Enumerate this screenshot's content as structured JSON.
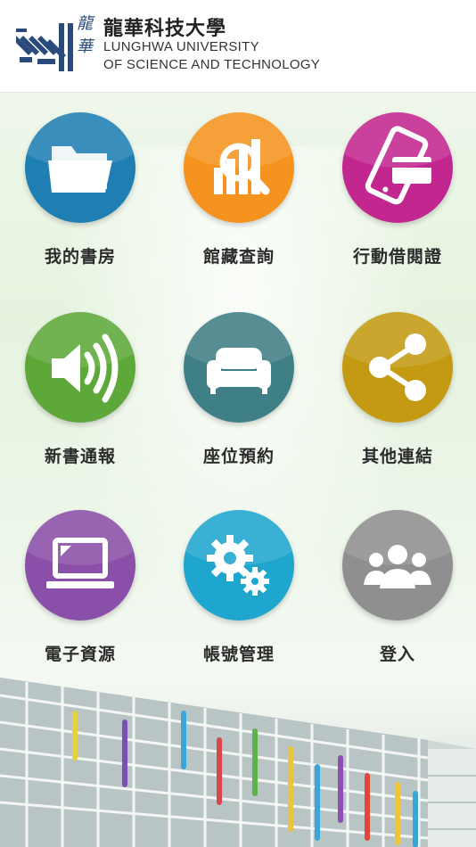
{
  "header": {
    "logo_calligraphy": "龍華",
    "name_zh": "龍華科技大學",
    "name_en_line1": "LUNGHWA UNIVERSITY",
    "name_en_line2": "OF SCIENCE AND TECHNOLOGY"
  },
  "menu": [
    {
      "label": "我的書房",
      "icon": "folder-icon",
      "color": "#1f7fb3"
    },
    {
      "label": "館藏查詢",
      "icon": "search-chart-icon",
      "color": "#f5931e"
    },
    {
      "label": "行動借閱證",
      "icon": "mobile-card-icon",
      "color": "#c2278f"
    },
    {
      "label": "新書通報",
      "icon": "megaphone-icon",
      "color": "#5ea83a"
    },
    {
      "label": "座位預約",
      "icon": "sofa-icon",
      "color": "#3f7f86"
    },
    {
      "label": "其他連結",
      "icon": "share-icon",
      "color": "#c49a12"
    },
    {
      "label": "電子資源",
      "icon": "laptop-icon",
      "color": "#8a4fa8"
    },
    {
      "label": "帳號管理",
      "icon": "gears-icon",
      "color": "#1ea6cf"
    },
    {
      "label": "登入",
      "icon": "users-icon",
      "color": "#8f8f8f"
    }
  ]
}
